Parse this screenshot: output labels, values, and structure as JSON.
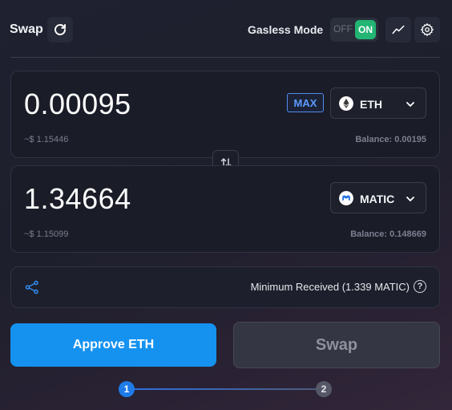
{
  "header": {
    "title": "Swap",
    "gasless_label": "Gasless Mode",
    "toggle_off": "OFF",
    "toggle_on": "ON",
    "icons": [
      "refresh-icon",
      "chart-icon",
      "settings-icon"
    ]
  },
  "from": {
    "amount": "0.00095",
    "usd": "~$ 1.15446",
    "balance": "Balance: 0.00195",
    "max_label": "MAX",
    "token": "ETH",
    "token_icon": "eth-icon"
  },
  "to": {
    "amount": "1.34664",
    "usd": "~$ 1.15099",
    "balance": "Balance: 0.148669",
    "token": "MATIC",
    "token_icon": "matic-icon"
  },
  "info": {
    "min_received": "Minimum Received (1.339 MATIC)",
    "help": "?"
  },
  "actions": {
    "approve_label": "Approve ETH",
    "swap_label": "Swap"
  },
  "steps": {
    "step1": "1",
    "step2": "2"
  },
  "colors": {
    "accent": "#1592f0",
    "toggle_on": "#22b573",
    "max_border": "#4f8cf0"
  }
}
